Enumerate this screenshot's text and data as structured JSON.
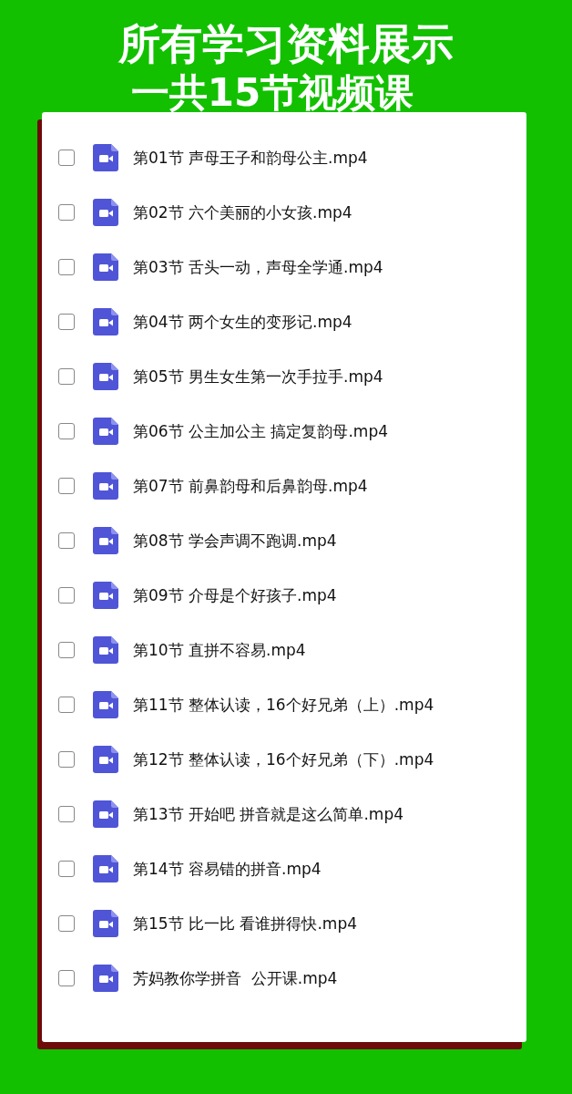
{
  "title": "所有学习资料展示",
  "subtitle": "一共15节视频课",
  "files": [
    {
      "name": "第01节 声母王子和韵母公主.mp4",
      "checked": false
    },
    {
      "name": "第02节 六个美丽的小女孩.mp4",
      "checked": false
    },
    {
      "name": "第03节 舌头一动，声母全学通.mp4",
      "checked": false
    },
    {
      "name": "第04节 两个女生的变形记.mp4",
      "checked": false
    },
    {
      "name": "第05节 男生女生第一次手拉手.mp4",
      "checked": false
    },
    {
      "name": "第06节 公主加公主 搞定复韵母.mp4",
      "checked": false
    },
    {
      "name": "第07节 前鼻韵母和后鼻韵母.mp4",
      "checked": false
    },
    {
      "name": "第08节 学会声调不跑调.mp4",
      "checked": false
    },
    {
      "name": "第09节 介母是个好孩子.mp4",
      "checked": false
    },
    {
      "name": "第10节 直拼不容易.mp4",
      "checked": false
    },
    {
      "name": "第11节 整体认读，16个好兄弟（上）.mp4",
      "checked": false
    },
    {
      "name": "第12节 整体认读，16个好兄弟（下）.mp4",
      "checked": false
    },
    {
      "name": "第13节 开始吧 拼音就是这么简单.mp4",
      "checked": false
    },
    {
      "name": "第14节 容易错的拼音.mp4",
      "checked": false
    },
    {
      "name": "第15节 比一比 看谁拼得快.mp4",
      "checked": false
    },
    {
      "name": "芳妈教你学拼音  公开课.mp4",
      "checked": false
    }
  ]
}
